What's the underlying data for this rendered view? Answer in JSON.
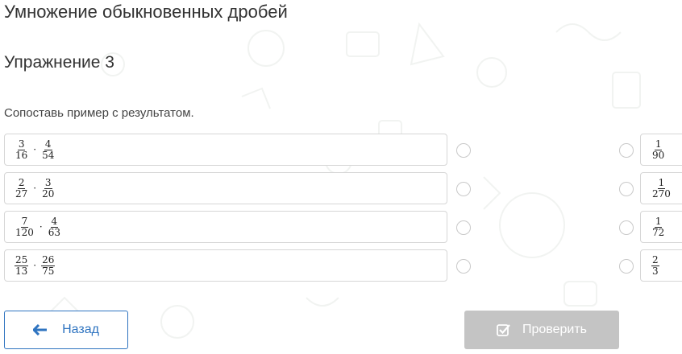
{
  "page": {
    "title": "Умножение обыкновенных дробей",
    "exercise": "Упражнение 3",
    "instruction": "Сопоставь пример с результатом."
  },
  "left_items": [
    {
      "a": {
        "num": "3",
        "den": "16"
      },
      "op": "·",
      "b": {
        "num": "4",
        "den": "54"
      }
    },
    {
      "a": {
        "num": "2",
        "den": "27"
      },
      "op": "·",
      "b": {
        "num": "3",
        "den": "20"
      }
    },
    {
      "a": {
        "num": "7",
        "den": "120"
      },
      "op": "·",
      "b": {
        "num": "4",
        "den": "63"
      }
    },
    {
      "a": {
        "num": "25",
        "den": "13"
      },
      "op": "·",
      "b": {
        "num": "26",
        "den": "75"
      }
    }
  ],
  "right_items": [
    {
      "num": "1",
      "den": "90"
    },
    {
      "num": "1",
      "den": "270"
    },
    {
      "num": "1",
      "den": "72"
    },
    {
      "num": "2",
      "den": "3"
    }
  ],
  "buttons": {
    "back_label": "Назад",
    "back_icon": "arrow-left-icon",
    "check_label": "Проверить",
    "check_icon": "check-square-icon"
  },
  "colors": {
    "accent": "#2f74c0",
    "disabled_button": "#c4c4c4",
    "card_border": "#d6d6d6",
    "radio_border": "#c9c9c9"
  }
}
